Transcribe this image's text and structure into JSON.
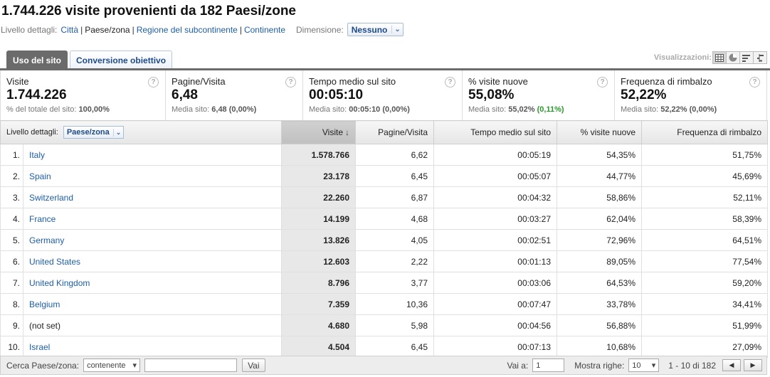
{
  "header": {
    "title": "1.744.226 visite provenienti da 182 Paesi/zone",
    "detail_label": "Livello dettagli:",
    "detail_options": [
      "Città",
      "Paese/zona",
      "Regione del subcontinente",
      "Continente"
    ],
    "dimension_label": "Dimensione:",
    "dimension_value": "Nessuno"
  },
  "tabs": [
    "Uso del sito",
    "Conversione obiettivo"
  ],
  "visualizations_label": "Visualizzazioni:",
  "metrics": [
    {
      "name": "Visite",
      "value": "1.744.226",
      "sub_label": "% del totale del sito:",
      "sub_value": "100,00%",
      "sub_delta": ""
    },
    {
      "name": "Pagine/Visita",
      "value": "6,48",
      "sub_label": "Media sito:",
      "sub_value": "6,48 (0,00%)",
      "sub_delta": ""
    },
    {
      "name": "Tempo medio sul sito",
      "value": "00:05:10",
      "sub_label": "Media sito:",
      "sub_value": "00:05:10 (0,00%)",
      "sub_delta": ""
    },
    {
      "name": "% visite nuove",
      "value": "55,08%",
      "sub_label": "Media sito:",
      "sub_value": "55,02%",
      "sub_delta": "(0,11%)"
    },
    {
      "name": "Frequenza di rimbalzo",
      "value": "52,22%",
      "sub_label": "Media sito:",
      "sub_value": "52,22% (0,00%)",
      "sub_delta": ""
    }
  ],
  "table": {
    "detail_label": "Livello dettagli:",
    "detail_value": "Paese/zona",
    "columns": [
      "Visite",
      "Pagine/Visita",
      "Tempo medio sul sito",
      "% visite nuove",
      "Frequenza di rimbalzo"
    ],
    "rows": [
      {
        "idx": "1.",
        "name": "Italy",
        "link": true,
        "visits": "1.578.766",
        "ppv": "6,62",
        "time": "00:05:19",
        "new": "54,35%",
        "bounce": "51,75%"
      },
      {
        "idx": "2.",
        "name": "Spain",
        "link": true,
        "visits": "23.178",
        "ppv": "6,45",
        "time": "00:05:07",
        "new": "44,77%",
        "bounce": "45,69%"
      },
      {
        "idx": "3.",
        "name": "Switzerland",
        "link": true,
        "visits": "22.260",
        "ppv": "6,87",
        "time": "00:04:32",
        "new": "58,86%",
        "bounce": "52,11%"
      },
      {
        "idx": "4.",
        "name": "France",
        "link": true,
        "visits": "14.199",
        "ppv": "4,68",
        "time": "00:03:27",
        "new": "62,04%",
        "bounce": "58,39%"
      },
      {
        "idx": "5.",
        "name": "Germany",
        "link": true,
        "visits": "13.826",
        "ppv": "4,05",
        "time": "00:02:51",
        "new": "72,96%",
        "bounce": "64,51%"
      },
      {
        "idx": "6.",
        "name": "United States",
        "link": true,
        "visits": "12.603",
        "ppv": "2,22",
        "time": "00:01:13",
        "new": "89,05%",
        "bounce": "77,54%"
      },
      {
        "idx": "7.",
        "name": "United Kingdom",
        "link": true,
        "visits": "8.796",
        "ppv": "3,77",
        "time": "00:03:06",
        "new": "64,53%",
        "bounce": "59,20%"
      },
      {
        "idx": "8.",
        "name": "Belgium",
        "link": true,
        "visits": "7.359",
        "ppv": "10,36",
        "time": "00:07:47",
        "new": "33,78%",
        "bounce": "34,41%"
      },
      {
        "idx": "9.",
        "name": "(not set)",
        "link": false,
        "visits": "4.680",
        "ppv": "5,98",
        "time": "00:04:56",
        "new": "56,88%",
        "bounce": "51,99%"
      },
      {
        "idx": "10.",
        "name": "Israel",
        "link": true,
        "visits": "4.504",
        "ppv": "6,45",
        "time": "00:07:13",
        "new": "10,68%",
        "bounce": "27,09%"
      }
    ]
  },
  "footer": {
    "search_label": "Cerca Paese/zona:",
    "match_value": "contenente",
    "search_value": "",
    "go_label": "Vai",
    "goto_label": "Vai a:",
    "goto_value": "1",
    "rows_label": "Mostra righe:",
    "rows_value": "10",
    "range_text": "1 - 10 di 182"
  }
}
